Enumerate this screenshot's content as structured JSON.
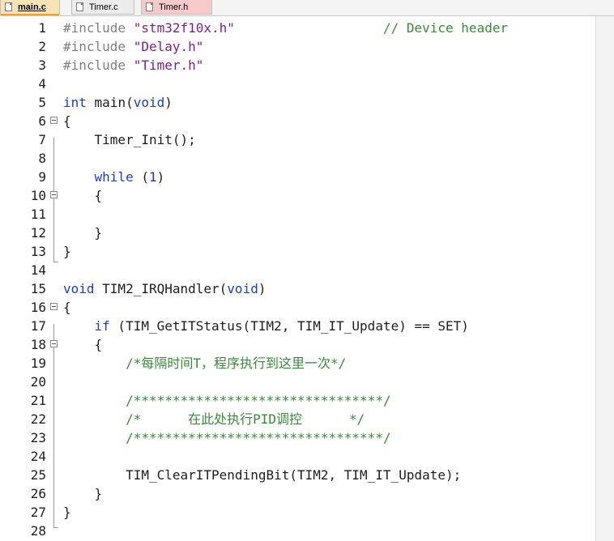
{
  "tabs": [
    {
      "label": "main.c",
      "active": true
    },
    {
      "label": "Timer.c",
      "active": false
    },
    {
      "label": "Timer.h",
      "active": false
    }
  ],
  "editor": {
    "lines": [
      {
        "n": "1",
        "t": [
          {
            "c": "pp",
            "s": "#include "
          },
          {
            "c": "str",
            "s": "\"stm32f10x.h\""
          },
          {
            "c": "",
            "s": "                   "
          },
          {
            "c": "cm",
            "s": "// Device header"
          }
        ]
      },
      {
        "n": "2",
        "t": [
          {
            "c": "pp",
            "s": "#include "
          },
          {
            "c": "str",
            "s": "\"Delay.h\""
          }
        ]
      },
      {
        "n": "3",
        "t": [
          {
            "c": "pp",
            "s": "#include "
          },
          {
            "c": "str",
            "s": "\"Timer.h\""
          }
        ]
      },
      {
        "n": "4",
        "t": []
      },
      {
        "n": "5",
        "t": [
          {
            "c": "kw",
            "s": "int"
          },
          {
            "c": "",
            "s": " main("
          },
          {
            "c": "kw",
            "s": "void"
          },
          {
            "c": "",
            "s": ")"
          }
        ]
      },
      {
        "n": "6",
        "t": [
          {
            "c": "",
            "s": "{"
          }
        ]
      },
      {
        "n": "7",
        "t": [
          {
            "c": "",
            "s": "    Timer_Init();"
          }
        ]
      },
      {
        "n": "8",
        "t": []
      },
      {
        "n": "9",
        "t": [
          {
            "c": "",
            "s": "    "
          },
          {
            "c": "kw",
            "s": "while"
          },
          {
            "c": "",
            "s": " ("
          },
          {
            "c": "num",
            "s": "1"
          },
          {
            "c": "",
            "s": ")"
          }
        ]
      },
      {
        "n": "10",
        "t": [
          {
            "c": "",
            "s": "    {"
          }
        ]
      },
      {
        "n": "11",
        "t": []
      },
      {
        "n": "12",
        "t": [
          {
            "c": "",
            "s": "    }"
          }
        ]
      },
      {
        "n": "13",
        "t": [
          {
            "c": "",
            "s": "}"
          }
        ]
      },
      {
        "n": "14",
        "t": []
      },
      {
        "n": "15",
        "t": [
          {
            "c": "kw",
            "s": "void"
          },
          {
            "c": "",
            "s": " TIM2_IRQHandler("
          },
          {
            "c": "kw",
            "s": "void"
          },
          {
            "c": "",
            "s": ")"
          }
        ]
      },
      {
        "n": "16",
        "t": [
          {
            "c": "",
            "s": "{"
          }
        ]
      },
      {
        "n": "17",
        "t": [
          {
            "c": "",
            "s": "    "
          },
          {
            "c": "kw",
            "s": "if"
          },
          {
            "c": "",
            "s": " (TIM_GetITStatus(TIM2, TIM_IT_Update) == SET)"
          }
        ]
      },
      {
        "n": "18",
        "t": [
          {
            "c": "",
            "s": "    {"
          }
        ]
      },
      {
        "n": "19",
        "t": [
          {
            "c": "",
            "s": "        "
          },
          {
            "c": "cm",
            "s": "/*每隔时间T，程序执行到这里一次*/"
          }
        ]
      },
      {
        "n": "20",
        "t": []
      },
      {
        "n": "21",
        "t": [
          {
            "c": "",
            "s": "        "
          },
          {
            "c": "cm",
            "s": "/********************************/"
          }
        ]
      },
      {
        "n": "22",
        "t": [
          {
            "c": "",
            "s": "        "
          },
          {
            "c": "cm",
            "s": "/*      在此处执行PID调控      */"
          }
        ]
      },
      {
        "n": "23",
        "t": [
          {
            "c": "",
            "s": "        "
          },
          {
            "c": "cm",
            "s": "/********************************/"
          }
        ]
      },
      {
        "n": "24",
        "t": []
      },
      {
        "n": "25",
        "t": [
          {
            "c": "",
            "s": "        TIM_ClearITPendingBit(TIM2, TIM_IT_Update);"
          }
        ]
      },
      {
        "n": "26",
        "t": [
          {
            "c": "",
            "s": "    }"
          }
        ]
      },
      {
        "n": "27",
        "t": [
          {
            "c": "",
            "s": "}"
          }
        ]
      },
      {
        "n": "28",
        "t": []
      }
    ]
  }
}
